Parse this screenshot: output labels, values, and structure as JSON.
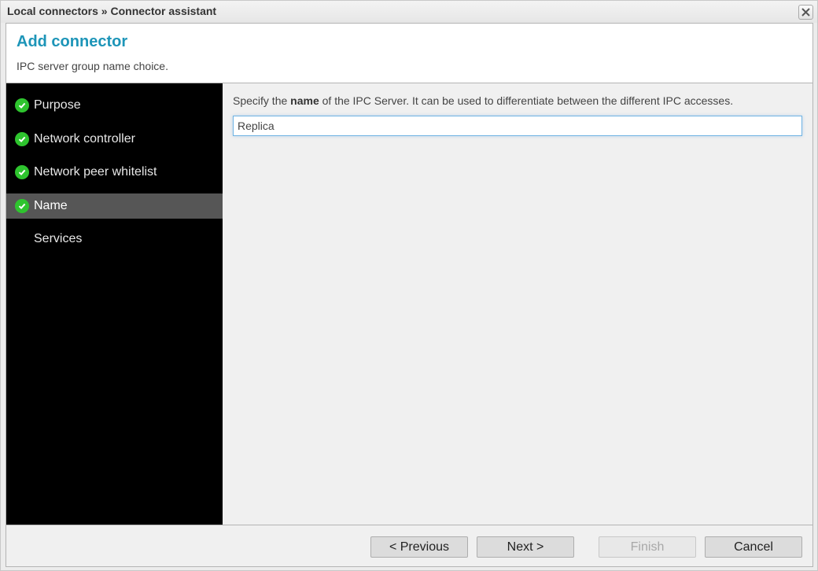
{
  "window": {
    "title": "Local connectors » Connector assistant",
    "close_icon": "close-x-icon"
  },
  "header": {
    "title": "Add connector",
    "subtitle": "IPC server group name choice."
  },
  "steps": [
    {
      "label": "Purpose",
      "completed": true,
      "active": false,
      "icon": "check-circle-icon"
    },
    {
      "label": "Network controller",
      "completed": true,
      "active": false,
      "icon": "check-circle-icon"
    },
    {
      "label": "Network peer whitelist",
      "completed": true,
      "active": false,
      "icon": "check-circle-icon"
    },
    {
      "label": "Name",
      "completed": true,
      "active": true,
      "icon": "check-circle-icon"
    },
    {
      "label": "Services",
      "completed": false,
      "active": false
    }
  ],
  "main": {
    "instruction_prefix": "Specify the ",
    "instruction_bold": "name",
    "instruction_suffix": " of the IPC Server. It can be used to differentiate between the different IPC accesses.",
    "name_value": "Replica"
  },
  "footer": {
    "previous_label": "< Previous",
    "next_label": "Next >",
    "finish_label": "Finish",
    "finish_enabled": false,
    "cancel_label": "Cancel"
  },
  "colors": {
    "title_accent": "#1d95b8",
    "check_green": "#2ec42e",
    "sidebar_bg": "#000000",
    "active_step_bg": "#565656",
    "input_focus_border": "#6fb3e3"
  }
}
